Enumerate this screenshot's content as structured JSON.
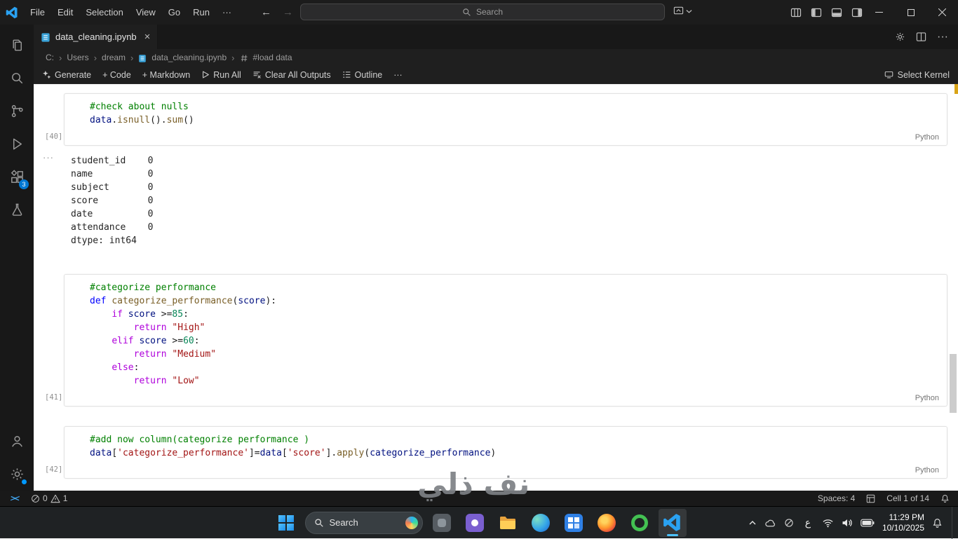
{
  "titlebar": {
    "menus": [
      "File",
      "Edit",
      "Selection",
      "View",
      "Go",
      "Run",
      "···"
    ],
    "search_placeholder": "Search"
  },
  "icons": {
    "remote_glyph": "><",
    "back_arrow": "←",
    "forward_arrow": "→",
    "more": "···",
    "tab_close": "×"
  },
  "tab": {
    "title": "data_cleaning.ipynb"
  },
  "breadcrumbs": {
    "items": [
      "C:",
      "Users",
      "dream",
      "data_cleaning.ipynb",
      "#load data"
    ],
    "separator": "›"
  },
  "toolbar": {
    "generate": "Generate",
    "add_code": "+ Code",
    "add_markdown": "+ Markdown",
    "run_all": "Run All",
    "clear_outputs": "Clear All Outputs",
    "outline": "Outline",
    "more": "···",
    "select_kernel": "Select Kernel"
  },
  "notebook": {
    "output_more": "···",
    "cells": [
      {
        "exec": "[40]",
        "lang": "Python",
        "lines": [
          [
            {
              "t": "#check about nulls",
              "c": "comment"
            }
          ],
          [
            {
              "t": "data",
              "c": "var"
            },
            {
              "t": ".",
              "c": "pln"
            },
            {
              "t": "isnull",
              "c": "fn"
            },
            {
              "t": "().",
              "c": "pln"
            },
            {
              "t": "sum",
              "c": "fn"
            },
            {
              "t": "()",
              "c": "pln"
            }
          ]
        ],
        "output": [
          "student_id    0",
          "name          0",
          "subject       0",
          "score         0",
          "date          0",
          "attendance    0",
          "dtype: int64"
        ]
      },
      {
        "exec": "[41]",
        "lang": "Python",
        "lines": [
          [
            {
              "t": "#categorize performance",
              "c": "comment"
            }
          ],
          [
            {
              "t": "def",
              "c": "kw"
            },
            {
              "t": " ",
              "c": "pln"
            },
            {
              "t": "categorize_performance",
              "c": "fn"
            },
            {
              "t": "(",
              "c": "pln"
            },
            {
              "t": "score",
              "c": "var"
            },
            {
              "t": "):",
              "c": "pln"
            }
          ],
          [
            {
              "t": "    ",
              "c": "pln"
            },
            {
              "t": "if",
              "c": "ctl"
            },
            {
              "t": " ",
              "c": "pln"
            },
            {
              "t": "score",
              "c": "var"
            },
            {
              "t": " >=",
              "c": "pln"
            },
            {
              "t": "85",
              "c": "num"
            },
            {
              "t": ":",
              "c": "pln"
            }
          ],
          [
            {
              "t": "        ",
              "c": "pln"
            },
            {
              "t": "return",
              "c": "ctl"
            },
            {
              "t": " ",
              "c": "pln"
            },
            {
              "t": "\"High\"",
              "c": "str"
            }
          ],
          [
            {
              "t": "    ",
              "c": "pln"
            },
            {
              "t": "elif",
              "c": "ctl"
            },
            {
              "t": " ",
              "c": "pln"
            },
            {
              "t": "score",
              "c": "var"
            },
            {
              "t": " >=",
              "c": "pln"
            },
            {
              "t": "60",
              "c": "num"
            },
            {
              "t": ":",
              "c": "pln"
            }
          ],
          [
            {
              "t": "        ",
              "c": "pln"
            },
            {
              "t": "return",
              "c": "ctl"
            },
            {
              "t": " ",
              "c": "pln"
            },
            {
              "t": "\"Medium\"",
              "c": "str"
            }
          ],
          [
            {
              "t": "    ",
              "c": "pln"
            },
            {
              "t": "else",
              "c": "ctl"
            },
            {
              "t": ":",
              "c": "pln"
            }
          ],
          [
            {
              "t": "        ",
              "c": "pln"
            },
            {
              "t": "return",
              "c": "ctl"
            },
            {
              "t": " ",
              "c": "pln"
            },
            {
              "t": "\"Low\"",
              "c": "str"
            }
          ]
        ]
      },
      {
        "exec": "[42]",
        "lang": "Python",
        "lines": [
          [
            {
              "t": "#add now column(categorize performance )",
              "c": "comment"
            }
          ],
          [
            {
              "t": "data",
              "c": "var"
            },
            {
              "t": "[",
              "c": "pln"
            },
            {
              "t": "'categorize_performance'",
              "c": "str"
            },
            {
              "t": "]=",
              "c": "pln"
            },
            {
              "t": "data",
              "c": "var"
            },
            {
              "t": "[",
              "c": "pln"
            },
            {
              "t": "'score'",
              "c": "str"
            },
            {
              "t": "].",
              "c": "pln"
            },
            {
              "t": "apply",
              "c": "fn"
            },
            {
              "t": "(",
              "c": "pln"
            },
            {
              "t": "categorize_performance",
              "c": "var"
            },
            {
              "t": ")",
              "c": "pln"
            }
          ]
        ]
      }
    ]
  },
  "statusbar": {
    "errors": "0",
    "warnings": "1",
    "spaces": "Spaces: 4",
    "cell_indicator": "Cell 1 of 14"
  },
  "taskbar": {
    "search_label": "Search",
    "language": "ع",
    "time": "11:29 PM",
    "date": "10/10/2025"
  },
  "watermark": "نف ذلي"
}
